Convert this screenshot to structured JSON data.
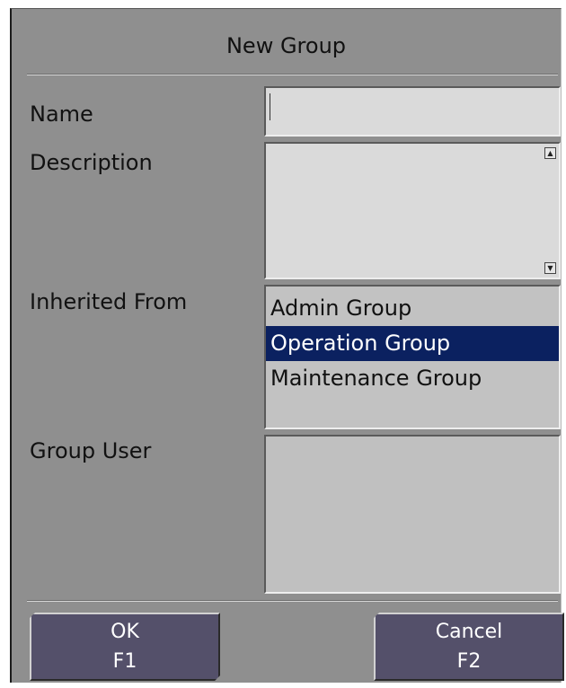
{
  "dialog": {
    "title": "New Group",
    "fields": {
      "name_label": "Name",
      "name_value": "",
      "description_label": "Description",
      "description_value": "",
      "inherited_label": "Inherited From",
      "group_user_label": "Group User"
    },
    "inherited_options": [
      "Admin Group",
      "Operation Group",
      "Maintenance Group"
    ],
    "inherited_selected": "Operation Group",
    "group_users": [],
    "buttons": {
      "ok_label": "OK",
      "ok_key": "F1",
      "cancel_label": "Cancel",
      "cancel_key": "F2"
    },
    "colors": {
      "selection": "#0b2160",
      "button": "#54506a",
      "background": "#8f8f8f"
    }
  }
}
